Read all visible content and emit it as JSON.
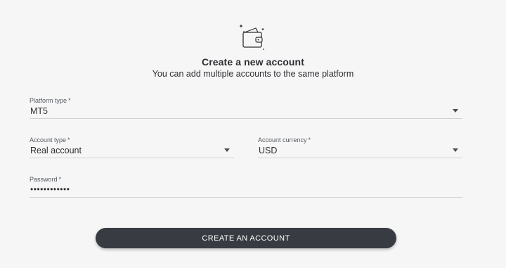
{
  "header": {
    "icon": "wallet-icon",
    "title": "Create a new account",
    "subtitle": "You can add multiple accounts to the same platform"
  },
  "form": {
    "platform_type": {
      "label": "Platform type",
      "required_mark": "*",
      "value": "MT5"
    },
    "account_type": {
      "label": "Account type",
      "required_mark": "*",
      "value": "Real account"
    },
    "account_currency": {
      "label": "Account currency",
      "required_mark": "*",
      "value": "USD"
    },
    "password": {
      "label": "Password",
      "required_mark": "*",
      "value": "••••••••••••"
    }
  },
  "actions": {
    "create_label": "CREATE AN ACCOUNT"
  },
  "colors": {
    "background": "#f6f6f6",
    "button": "#383c42",
    "text": "#2d2f33",
    "underline": "#cfd1d4"
  }
}
